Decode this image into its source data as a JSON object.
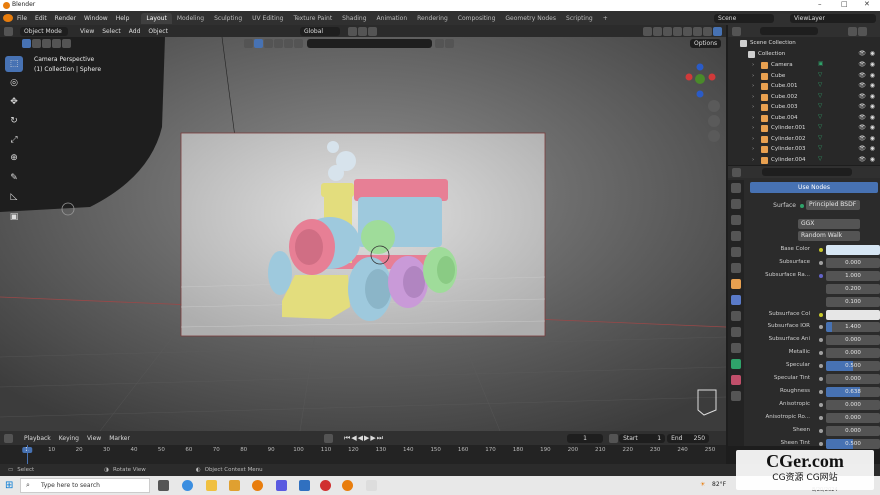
{
  "window": {
    "title": "Blender",
    "controls": [
      "–",
      "□",
      "✕"
    ]
  },
  "menu": {
    "items": [
      "File",
      "Edit",
      "Render",
      "Window",
      "Help"
    ]
  },
  "workspaces": {
    "tabs": [
      "Layout",
      "Modeling",
      "Sculpting",
      "UV Editing",
      "Texture Paint",
      "Shading",
      "Animation",
      "Rendering",
      "Compositing",
      "Geometry Nodes",
      "Scripting"
    ],
    "active": "Layout",
    "add": "+"
  },
  "scene": {
    "label": "Scene",
    "view_layer": "ViewLayer"
  },
  "viewport_header": {
    "mode": "Object Mode",
    "menus": [
      "View",
      "Select",
      "Add",
      "Object"
    ],
    "transform": "Global",
    "options": "Options"
  },
  "viewport": {
    "camera_label": "Camera Perspective",
    "collection_label": "(1) Collection | Sphere"
  },
  "outliner": {
    "root": "Scene Collection",
    "collection": "Collection",
    "items": [
      "Camera",
      "Cube",
      "Cube.001",
      "Cube.002",
      "Cube.003",
      "Cube.004",
      "Cylinder.001",
      "Cylinder.002",
      "Cylinder.003",
      "Cylinder.004"
    ]
  },
  "properties": {
    "use_nodes": "Use Nodes",
    "surface_label": "Surface",
    "surface_value": "Principled BSDF",
    "distribution": "GGX",
    "subsurface_method": "Random Walk",
    "rows": [
      {
        "label": "Base Color",
        "type": "color",
        "color": "#d6e6f4",
        "dot": "yellow"
      },
      {
        "label": "Subsurface",
        "value": "0.000",
        "dot": "grey"
      },
      {
        "label": "Subsurface Ra...",
        "value": "1.000",
        "dot": "purple"
      },
      {
        "label": "",
        "value": "0.200"
      },
      {
        "label": "",
        "value": "0.100"
      },
      {
        "label": "Subsurface Col",
        "type": "color",
        "color": "#e6e6e6",
        "dot": "yellow"
      },
      {
        "label": "Subsurface IOR",
        "value": "1.400",
        "dot": "grey",
        "fill": 0.12
      },
      {
        "label": "Subsurface Ani",
        "value": "0.000",
        "dot": "grey"
      },
      {
        "label": "Metallic",
        "value": "0.000",
        "dot": "grey"
      },
      {
        "label": "Specular",
        "value": "0.500",
        "dot": "grey",
        "fill": 0.5
      },
      {
        "label": "Specular Tint",
        "value": "0.000",
        "dot": "grey"
      },
      {
        "label": "Roughness",
        "value": "0.638",
        "dot": "grey",
        "fill": 0.638
      },
      {
        "label": "Anisotropic",
        "value": "0.000",
        "dot": "grey"
      },
      {
        "label": "Anisotropic Ro...",
        "value": "0.000",
        "dot": "grey"
      },
      {
        "label": "Sheen",
        "value": "0.000",
        "dot": "grey"
      },
      {
        "label": "Sheen Tint",
        "value": "0.500",
        "dot": "grey",
        "fill": 0.5
      }
    ]
  },
  "timeline": {
    "menus": [
      "Playback",
      "Keying",
      "View",
      "Marker"
    ],
    "current_frame": "1",
    "start_label": "Start",
    "start": "1",
    "end_label": "End",
    "end": "250",
    "ticks": [
      "1",
      "10",
      "20",
      "30",
      "40",
      "50",
      "60",
      "70",
      "80",
      "90",
      "100",
      "110",
      "120",
      "130",
      "140",
      "150",
      "160",
      "170",
      "180",
      "190",
      "200",
      "210",
      "220",
      "230",
      "240",
      "250"
    ]
  },
  "status": {
    "select": "Select",
    "rotate": "Rotate View",
    "context": "Object Context Menu"
  },
  "taskbar": {
    "search_placeholder": "Type here to search",
    "temp": "82°F",
    "date": "8/20/2024"
  },
  "watermark": {
    "line1": "CGer.com",
    "line2": "CG资源 CG网站"
  },
  "colors": {
    "accent": "#4772b3",
    "viewport_bg": "#4a4a4a",
    "panel": "#2b2b2b",
    "orange": "#e87d0d"
  }
}
